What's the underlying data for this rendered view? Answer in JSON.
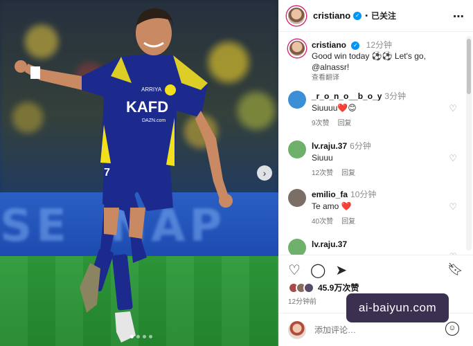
{
  "post": {
    "photo_alt": "player-photo",
    "header": {
      "username": "cristiano",
      "separator": "•",
      "follow_status": "已关注",
      "more": "⋯"
    },
    "caption": {
      "username": "cristiano",
      "time": "12分钟",
      "text_line1": "Good win today ⚽⚽ Let's go,",
      "text_line2": "@alnassr!",
      "translate": "查看翻译"
    },
    "comments": [
      {
        "username": "_r_o_n_o__b_o_y",
        "time": "3分钟",
        "text": "Siuuuu❤️😊",
        "likes": "9次赞",
        "reply": "回复",
        "avatar_color": "#3b8fd6"
      },
      {
        "username": "lv.raju.37",
        "time": "6分钟",
        "text": "Siuuu",
        "likes": "12次赞",
        "reply": "回复",
        "avatar_color": "#6fb06a"
      },
      {
        "username": "emilio_fa",
        "time": "10分钟",
        "text": "Te amo ❤️",
        "likes": "40次赞",
        "reply": "回复",
        "avatar_color": "#7a6e66"
      },
      {
        "username": "lv.raju.37",
        "time": "",
        "text": "",
        "likes": "",
        "reply": "",
        "avatar_color": "#6fb06a"
      }
    ],
    "likes_count": "45.9万次赞",
    "posted_time": "12分钟前",
    "add_comment_placeholder": "添加评论…"
  },
  "jersey": {
    "sponsor": "KAFD",
    "number": "7",
    "brand": "ARRIYA",
    "web": "DAZN.com"
  },
  "watermark": "ai-baiyun.com",
  "colors": {
    "verified": "#0095f6",
    "jersey": "#1b2a8c",
    "jersey_trim": "#f2e01c",
    "heart": "#ed4956"
  }
}
